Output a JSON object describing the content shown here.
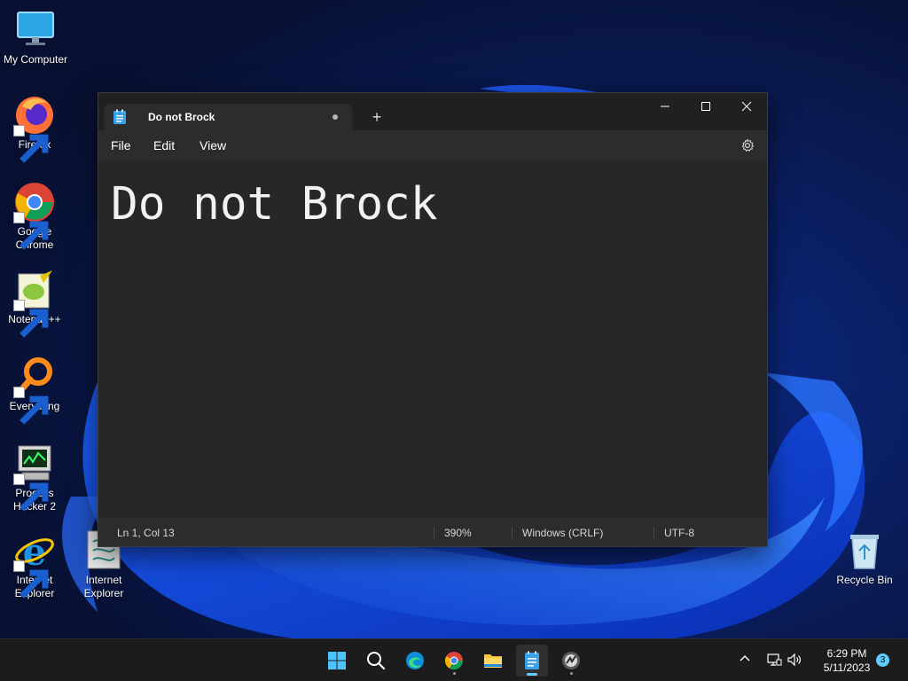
{
  "desktop": {
    "icons": [
      {
        "label": "My Computer",
        "icon": "monitor-icon"
      },
      {
        "label": "Firefox",
        "icon": "firefox-icon"
      },
      {
        "label": "Google Chrome",
        "icon": "chrome-icon"
      },
      {
        "label": "Notepad++",
        "icon": "notepadpp-icon"
      },
      {
        "label": "Everything",
        "icon": "everything-search-icon"
      },
      {
        "label": "Process Hacker 2",
        "icon": "process-hacker-icon"
      },
      {
        "label": "Internet Explorer",
        "icon": "internet-explorer-icon"
      },
      {
        "label": "Internet Explorer",
        "icon": "internet-explorer-legacy-icon"
      },
      {
        "label": "Recycle Bin",
        "icon": "recycle-bin-icon"
      }
    ]
  },
  "notepad": {
    "tab_title": "Do not Brock",
    "menu": [
      "File",
      "Edit",
      "View"
    ],
    "content": "Do not Brock",
    "status": {
      "position": "Ln 1, Col 13",
      "zoom": "390%",
      "line_ending": "Windows (CRLF)",
      "encoding": "UTF-8"
    }
  },
  "taskbar": {
    "apps": [
      "start-icon",
      "search-icon",
      "edge-icon",
      "chrome-icon",
      "file-explorer-icon",
      "notepad-icon",
      "process-hacker-icon"
    ],
    "clock": {
      "time": "6:29 PM",
      "date": "5/11/2023"
    },
    "notification_count": "3"
  },
  "colors": {
    "accent": "#60cdff",
    "window_bg": "#272727",
    "titlebar_bg": "#202020",
    "taskbar_bg": "#1c1c1c"
  }
}
